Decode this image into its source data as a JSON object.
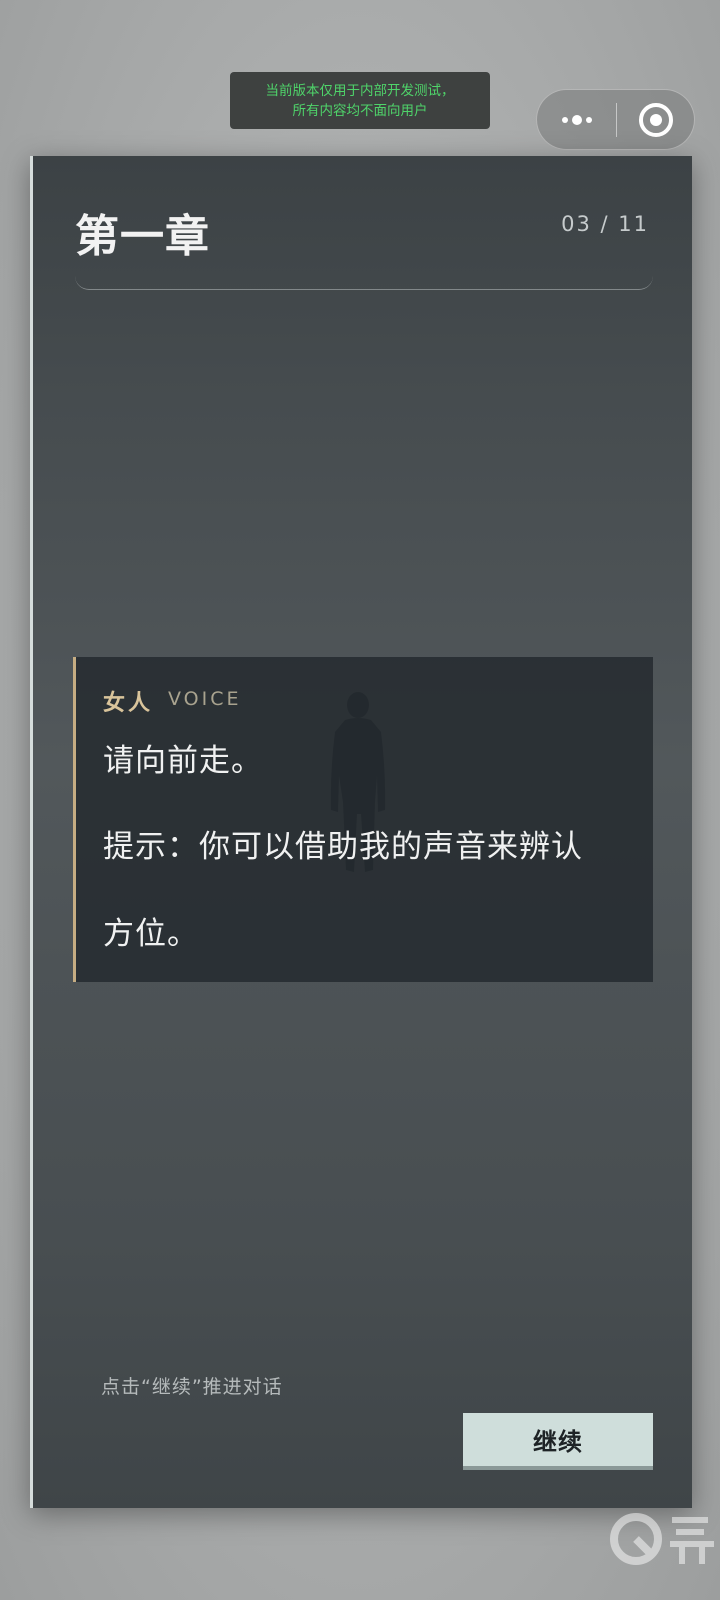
{
  "system": {
    "dev_banner_line1": "当前版本仅用于内部开发测试，",
    "dev_banner_line2": "所有内容均不面向用户",
    "capsule": {
      "more_icon": "more-dots-icon",
      "close_icon": "target-circle-icon"
    }
  },
  "chapter": {
    "title": "第一章",
    "progress": "03 / 11"
  },
  "dialog": {
    "speaker": "女人",
    "speaker_tag": "VOICE",
    "lines": [
      "请向前走。",
      "提示：你可以借助我的声音来辨认",
      "方位。"
    ]
  },
  "footer": {
    "hint": "点击“继续”推进对话",
    "continue_label": "继续"
  },
  "colors": {
    "card_bg": "#474d50",
    "dialog_accent": "#c6ad83",
    "speaker_color": "#d9c49b",
    "button_bg": "#cfdedb",
    "banner_text": "#4fd46a"
  }
}
